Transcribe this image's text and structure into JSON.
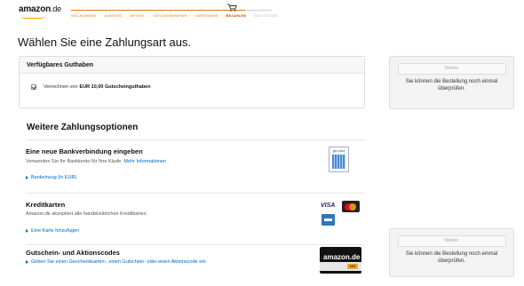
{
  "header": {
    "logo": "amazon",
    "logo_suffix": ".de",
    "steps": [
      "WILLKOMMEN",
      "ADRESSE",
      "ARTIKEL",
      "GESCHENKPAPIER",
      "VERSENDEN",
      "BEZAHLEN",
      "BESTÄTIGEN"
    ],
    "current_step": "BEZAHLEN",
    "accent_color": "#e47911"
  },
  "page_title": "Wählen Sie eine Zahlungsart aus.",
  "balance_box": {
    "title": "Verfügbares Guthaben",
    "checkbox_checked": true,
    "text_before": "Verrechnen von",
    "amount": "EUR 10,00 Gutscheinguthaben"
  },
  "side_panel": {
    "button_label": "Weiter",
    "text": "Sie können die Bestellung noch einmal überprüfen."
  },
  "options_title": "Weitere Zahlungsoptionen",
  "bank": {
    "title": "Eine neue Bankverbindung eingeben",
    "subtitle": "Verwenden Sie Ihr Bankkonto für Ihre Käufe.",
    "more_link": "Mehr Informationen",
    "link": "Bankeinzug (in EUR)",
    "icon": "giropay-icon",
    "icon_label": "giro card"
  },
  "card": {
    "title": "Kreditkarten",
    "subtitle": "Amazon.de akzeptiert alle handelsüblichen Kreditkarten",
    "link": "Eine Karte hinzufügen",
    "visa_label": "VISA"
  },
  "voucher": {
    "title": "Gutschein- und Aktionscodes",
    "link": "Geben Sie einen Geschenkkarten-, einen Gutschein- oder einen Aktionscode ein",
    "card_logo": "amazon.de",
    "card_tag": "€€€"
  }
}
